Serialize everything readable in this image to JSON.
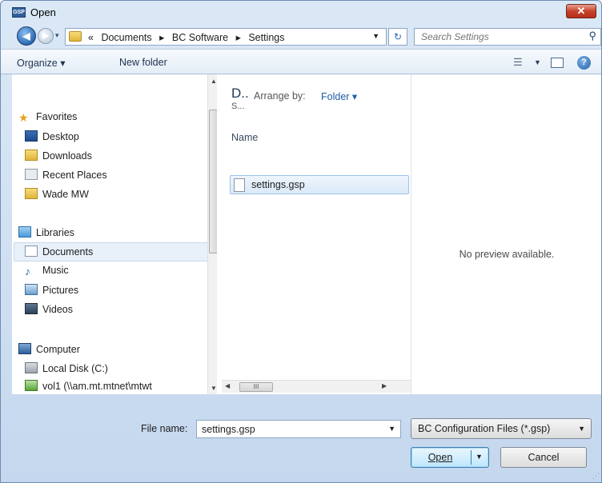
{
  "window": {
    "title": "Open",
    "app_icon_text": "GSP",
    "close_label": "✕"
  },
  "navigation": {
    "back_glyph": "◀",
    "forward_glyph": "▶",
    "breadcrumb": [
      "«",
      "Documents",
      "▸",
      "BC Software",
      "▸",
      "Settings"
    ],
    "refresh_glyph": "↻"
  },
  "search": {
    "placeholder": "Search Settings"
  },
  "toolbar": {
    "organize_label": "Organize ▾",
    "new_folder_label": "New folder"
  },
  "sidebar": {
    "favorites": {
      "label": "Favorites",
      "items": [
        "Desktop",
        "Downloads",
        "Recent Places",
        "Wade MW"
      ]
    },
    "libraries": {
      "label": "Libraries",
      "items": [
        "Documents",
        "Music",
        "Pictures",
        "Videos"
      ],
      "selected": "Documents"
    },
    "computer": {
      "label": "Computer",
      "items": [
        "Local Disk (C:)",
        "vol1 (\\\\am.mt.mtnet\\mtwt"
      ]
    }
  },
  "file_list": {
    "library_title": "D..",
    "library_subtitle": "S...",
    "arrange_by_label": "Arrange by:",
    "arrange_by_value": "Folder ▾",
    "column_name": "Name",
    "files": [
      "settings.gsp"
    ],
    "hscroll_thumb": "III"
  },
  "preview": {
    "message": "No preview available."
  },
  "footer": {
    "file_name_label": "File name:",
    "file_name_value": "settings.gsp",
    "file_type_value": "BC Configuration Files (*.gsp)",
    "open_label": "Open",
    "cancel_label": "Cancel"
  },
  "colors": {
    "accent": "#1e5ca6",
    "titlebar": "#dbe8f6",
    "close": "#c7422b",
    "selection": "#dbe9f8"
  }
}
